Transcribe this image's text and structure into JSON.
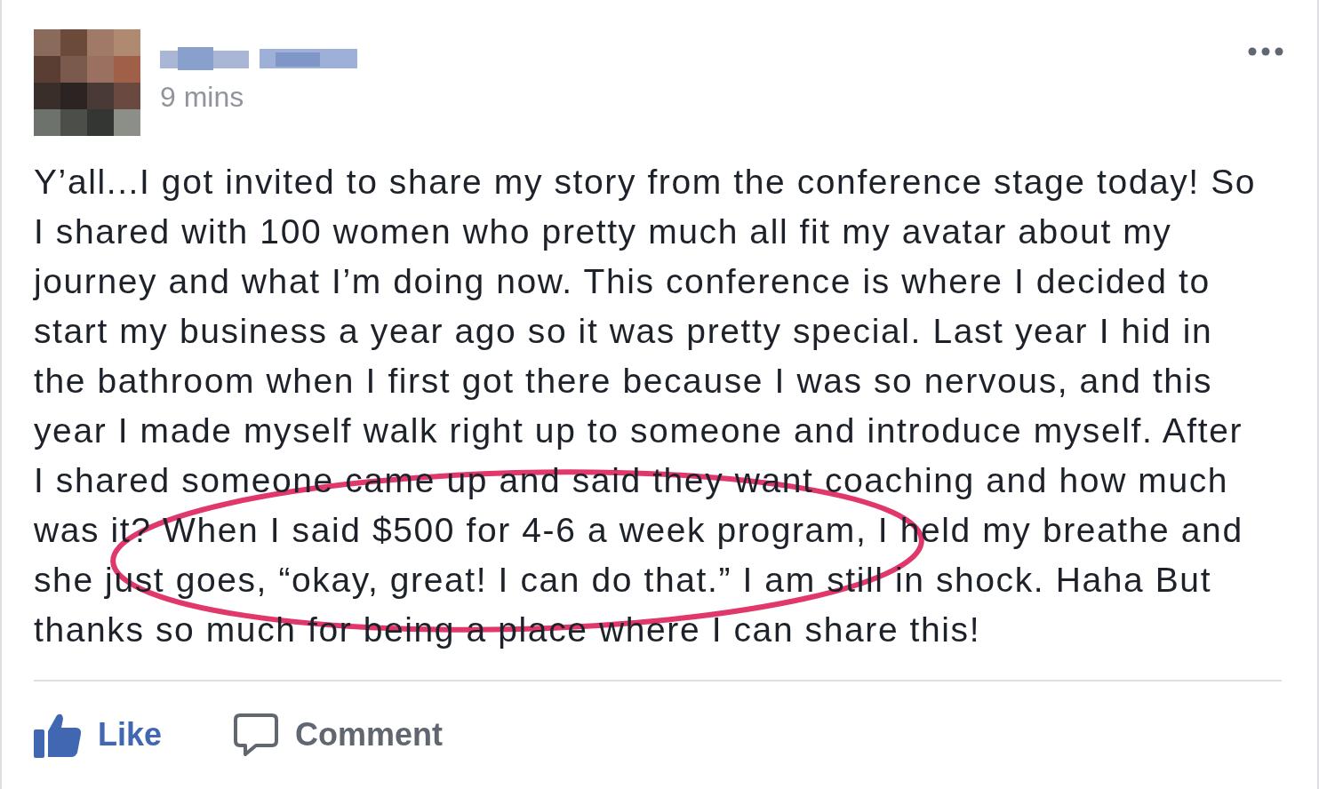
{
  "post": {
    "time": "9 mins",
    "body_lines": [
      "Y’all...I got invited to share my story from the conference stage today! So",
      "I shared with 100 women who pretty much all fit my avatar about my",
      "journey and what I’m doing now. This conference is where I decided to",
      "start my business a year ago so it was pretty special. Last year I hid in",
      "the bathroom when I first got there because I was so nervous, and this",
      "year I made myself walk right up to someone and introduce myself. After",
      "I shared someone came up and said they want coaching and how much",
      "was it? When I said $500 for 4-6 a week program, I held my breathe and",
      "she just goes, “okay, great! I can do that.” I am still in shock. Haha But",
      "thanks so much for being a place where I can share this!"
    ],
    "actions": [
      {
        "label": "Like",
        "kind": "like"
      },
      {
        "label": "Comment",
        "kind": "comment"
      }
    ]
  }
}
